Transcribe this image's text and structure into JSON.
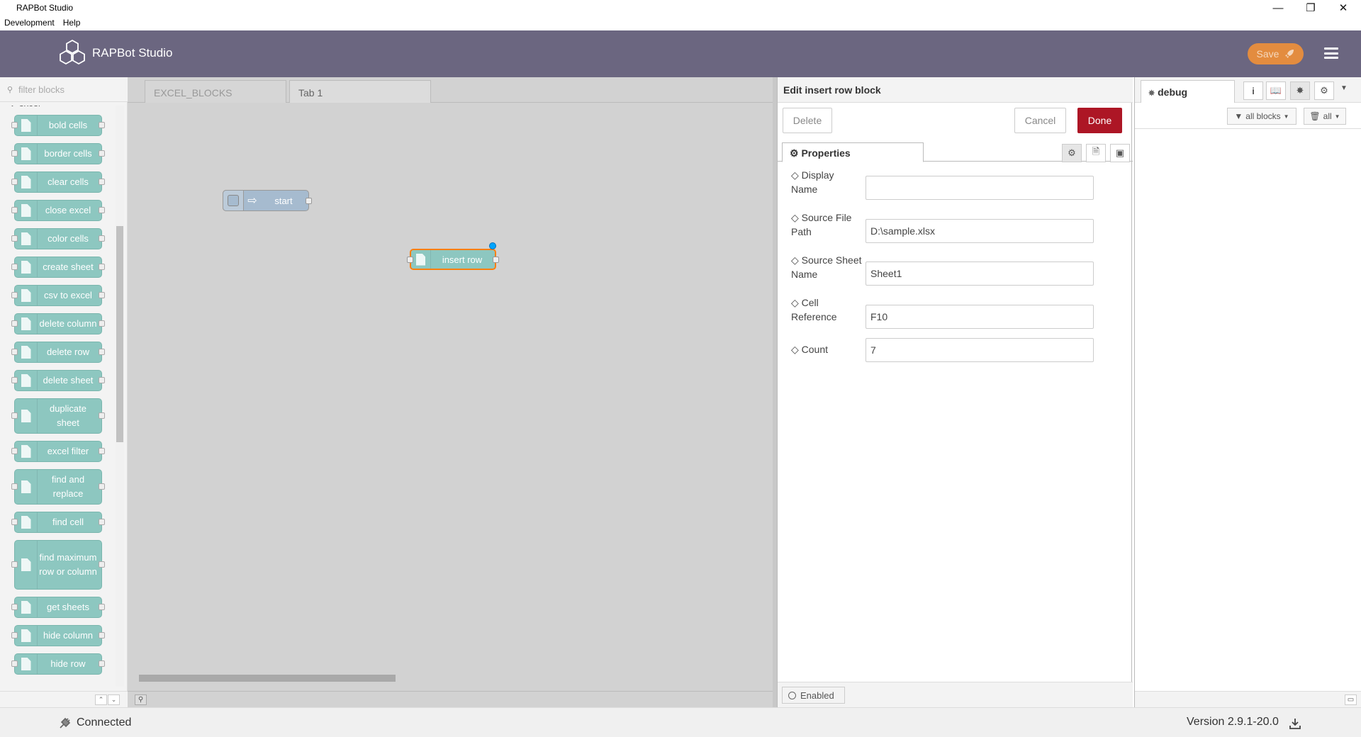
{
  "window": {
    "title": "RAPBot Studio",
    "menu": [
      "Development",
      "Help"
    ]
  },
  "header": {
    "brand": "RAPBot Studio",
    "save_label": "Save"
  },
  "palette": {
    "filter_placeholder": "filter blocks",
    "category": "excel",
    "nodes": [
      "bold cells",
      "border cells",
      "clear cells",
      "close excel",
      "color cells",
      "create sheet",
      "csv to excel",
      "delete column",
      "delete row",
      "delete sheet",
      "duplicate sheet",
      "excel filter",
      "find and replace",
      "find cell",
      "find maximum row or column",
      "get sheets",
      "hide column",
      "hide row"
    ]
  },
  "workspace": {
    "tabs": [
      "EXCEL_BLOCKS",
      "Tab 1"
    ],
    "active_tab": "Tab 1",
    "nodes": [
      {
        "label": "start",
        "type": "inject"
      },
      {
        "label": "insert row",
        "type": "excel",
        "selected": true
      }
    ]
  },
  "editor": {
    "title": "Edit insert row block",
    "delete_label": "Delete",
    "cancel_label": "Cancel",
    "done_label": "Done",
    "properties_tab": "Properties",
    "fields": [
      {
        "label": "Display Name",
        "value": ""
      },
      {
        "label": "Source File Path",
        "value": "D:\\sample.xlsx"
      },
      {
        "label": "Source Sheet Name",
        "value": "Sheet1"
      },
      {
        "label": "Cell Reference",
        "value": "F10"
      },
      {
        "label": "Count",
        "value": "7"
      }
    ],
    "enabled_label": "Enabled"
  },
  "sidebar": {
    "tab_label": "debug",
    "filter_label": "all blocks",
    "clear_label": "all"
  },
  "status": {
    "connection": "Connected",
    "version": "Version 2.9.1-20.0"
  },
  "colors": {
    "header": "#6b6680",
    "save_button": "#e38c3f",
    "done_button": "#ad1625",
    "excel_node": "#8dc7c0",
    "inject_node": "#a6bbcf",
    "selection": "#ff7f0e"
  }
}
